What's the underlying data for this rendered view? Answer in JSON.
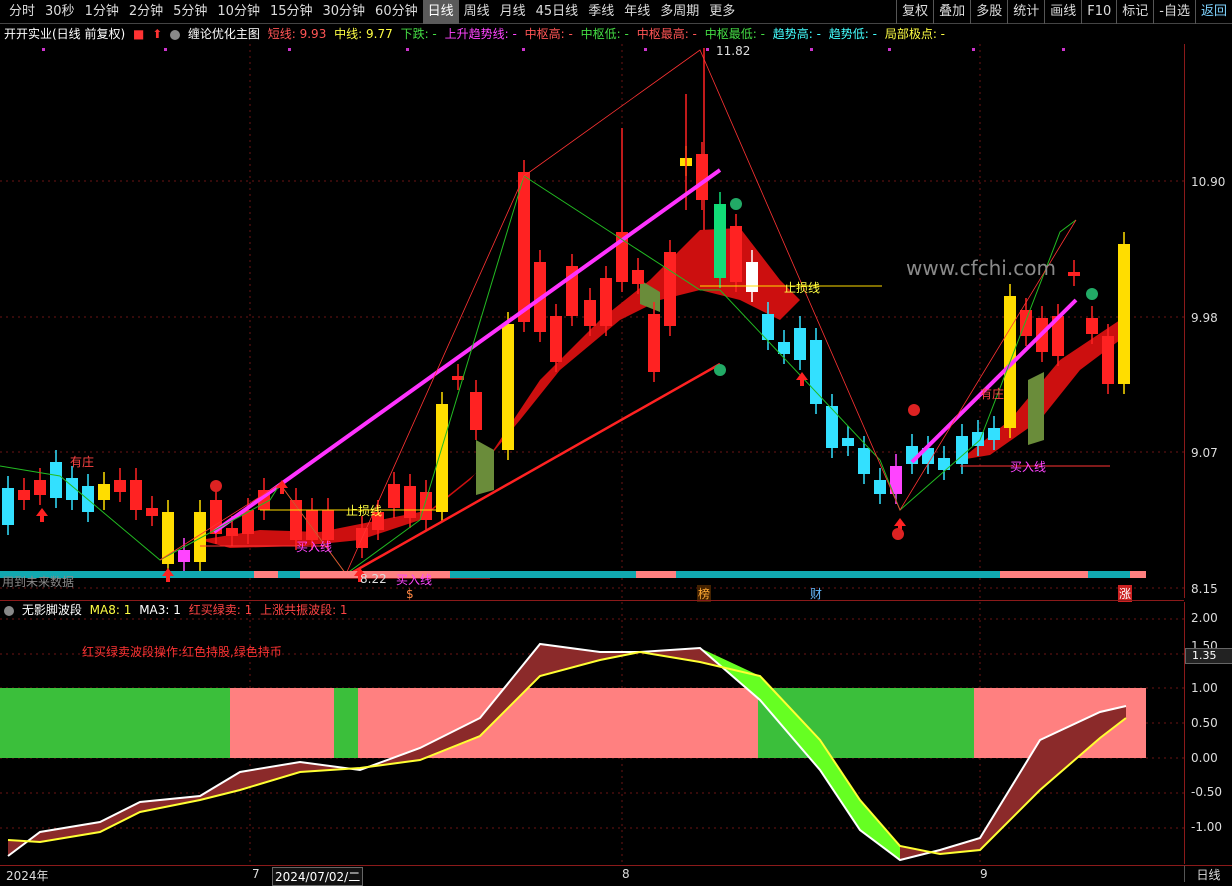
{
  "toolbar": {
    "periods": [
      "分时",
      "30秒",
      "1分钟",
      "2分钟",
      "5分钟",
      "10分钟",
      "15分钟",
      "30分钟",
      "60分钟",
      "日线",
      "周线",
      "月线",
      "45日线",
      "季线",
      "年线",
      "多周期",
      "更多"
    ],
    "active_period": "日线",
    "right_buttons": [
      "复权",
      "叠加",
      "多股",
      "统计",
      "画线",
      "F10",
      "标记",
      "-自选",
      "返回"
    ]
  },
  "main_info": {
    "stock_title": "开开实业(日线 前复权)",
    "indicator_name": "缠论优化主图",
    "short_line": "短线: 9.93",
    "mid_line": "中线: 9.77",
    "down": "下跌: -",
    "up_trend": "上升趋势线: -",
    "center_high": "中枢高: -",
    "center_low": "中枢低: -",
    "center_max": "中枢最高: -",
    "center_min": "中枢最低: -",
    "trend_high": "趋势高: -",
    "trend_low": "趋势低: -",
    "local_extreme": "局部极点: -",
    "colors": {
      "short": "#ff4444",
      "mid": "#ffff44",
      "down": "#44dd44",
      "up": "#ff44ff",
      "center": "#ff4444",
      "trend": "#44ffff",
      "local": "#ffff44"
    }
  },
  "sub_info": {
    "name": "无影脚波段",
    "ma8": "MA8: 1",
    "ma3": "MA3: 1",
    "red_buy": "红买绿卖: 1",
    "up_resonance": "上涨共振波段: 1",
    "note": "红买绿卖波段操作:红色持股,绿色持币"
  },
  "main_axis": {
    "ticks": [
      "10.90",
      "9.98",
      "9.07",
      "8.15"
    ]
  },
  "sub_axis": {
    "ticks": [
      "2.00",
      "1.50",
      "1.00",
      "0.50",
      "0.00",
      "-0.50",
      "-1.00"
    ],
    "current": "1.35"
  },
  "x_axis": {
    "labels": [
      "2024年",
      "7",
      "2024/07/02/二",
      "8",
      "9"
    ],
    "timeframe": "日线"
  },
  "annotations": {
    "high_price": "11.82",
    "low_price": "8.22",
    "stop_loss": "止损线",
    "buy_line": "买入线",
    "has_dealer": "有庄",
    "no_future_data": "用到未来数据",
    "watermark": "www.cfchi.com",
    "bottom_tags": [
      "$",
      "榜",
      "财",
      "涨"
    ]
  }
}
